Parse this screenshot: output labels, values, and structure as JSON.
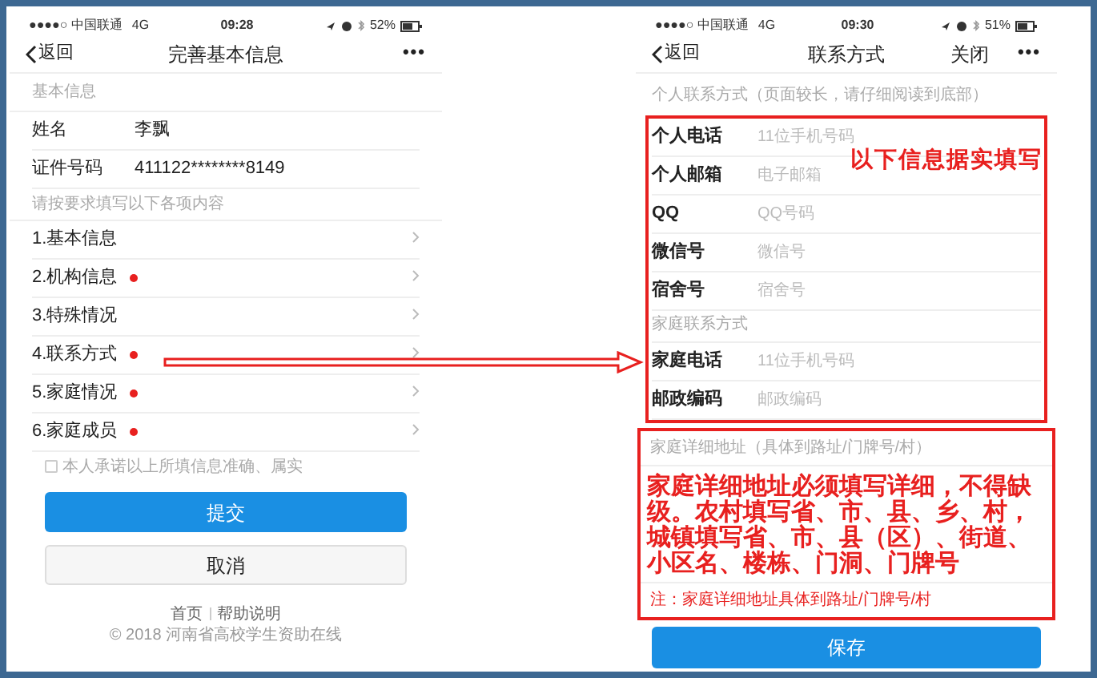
{
  "left_screen": {
    "status_bar": {
      "carrier": "●●●●○ 中国联通",
      "network": "4G",
      "time": "09:28",
      "battery": "52%"
    },
    "nav": {
      "back": "返回",
      "title": "完善基本信息",
      "more": "•••"
    },
    "basic_header": "基本信息",
    "fields": [
      {
        "label": "姓名",
        "value": "李飘"
      },
      {
        "label": "证件号码",
        "value": "411122********8149"
      }
    ],
    "sections_header": "请按要求填写以下各项内容",
    "sections": [
      {
        "label": "1.基本信息",
        "required": false
      },
      {
        "label": "2.机构信息",
        "required": true
      },
      {
        "label": "3.特殊情况",
        "required": false
      },
      {
        "label": "4.联系方式",
        "required": true
      },
      {
        "label": "5.家庭情况",
        "required": true
      },
      {
        "label": "6.家庭成员",
        "required": true
      }
    ],
    "pledge": {
      "label": "本人承诺以上所填信息准确、属实",
      "checked": false
    },
    "buttons": [
      {
        "label": "提交",
        "kind": "primary"
      },
      {
        "label": "取消",
        "kind": "secondary"
      }
    ],
    "footer_links": [
      "首页",
      "帮助说明"
    ],
    "copyright": "© 2018 河南省高校学生资助在线"
  },
  "right_screen": {
    "status_bar": {
      "carrier": "●●●●○ 中国联通",
      "network": "4G",
      "time": "09:30",
      "battery": "51%"
    },
    "nav": {
      "back": "返回",
      "title": "联系方式",
      "close": "关闭",
      "more": "•••"
    },
    "personal_header": "个人联系方式（页面较长，请仔细阅读到底部）",
    "personal_fields": [
      {
        "label": "个人电话",
        "placeholder": "11位手机号码"
      },
      {
        "label": "个人邮箱",
        "placeholder": "电子邮箱"
      },
      {
        "label": "QQ",
        "placeholder": "QQ号码"
      },
      {
        "label": "微信号",
        "placeholder": "微信号"
      },
      {
        "label": "宿舍号",
        "placeholder": "宿舍号"
      }
    ],
    "family_header": "家庭联系方式",
    "family_fields": [
      {
        "label": "家庭电话",
        "placeholder": "11位手机号码"
      },
      {
        "label": "邮政编码",
        "placeholder": "邮政编码"
      }
    ],
    "address": {
      "header": "家庭详细地址（具体到路址/门牌号/村）",
      "note": "注：家庭详细地址具体到路址/门牌号/村"
    },
    "save": "保存"
  },
  "annotations": [
    "以下信息据实填写",
    "家庭详细地址必须填写详细，不得缺级。农村填写省、市、县、乡、村，城镇填写省、市、县（区）、街道、小区名、楼栋、门洞、门牌号"
  ]
}
